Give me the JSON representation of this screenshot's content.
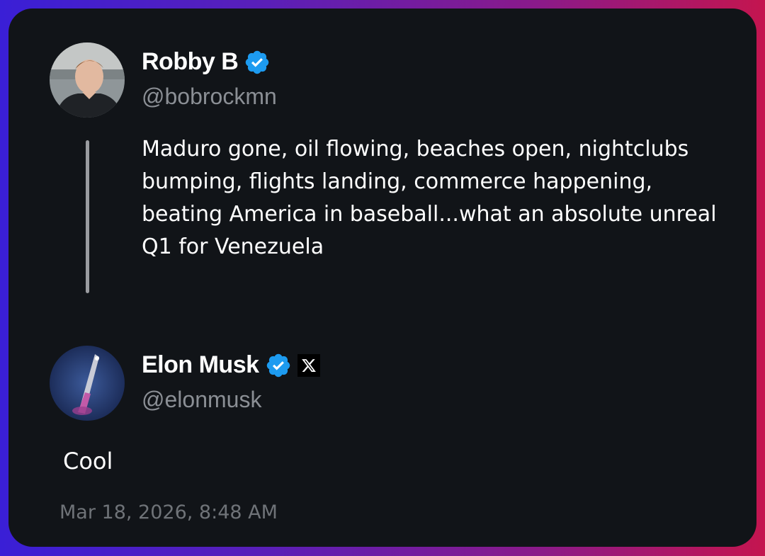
{
  "original_tweet": {
    "author_name": "Robby B",
    "author_handle": "@bobrockmn",
    "verified": true,
    "text": "Maduro gone, oil flowing, beaches open, nightclubs bumping, flights landing, commerce happening, beating America in baseball...what an absolute unreal Q1 for Venezuela"
  },
  "reply_tweet": {
    "author_name": "Elon Musk",
    "author_handle": "@elonmusk",
    "verified": true,
    "affiliate_badge": "x-logo-icon",
    "text": "Cool",
    "timestamp": "Mar 18, 2026, 8:48 AM"
  },
  "colors": {
    "card_background": "#111418",
    "verified_blue": "#1d9bf0",
    "handle_gray": "#8b8f95",
    "timestamp_gray": "#6f7378",
    "frame_gradient_start": "#3a1fd6",
    "frame_gradient_end": "#c4154f"
  }
}
